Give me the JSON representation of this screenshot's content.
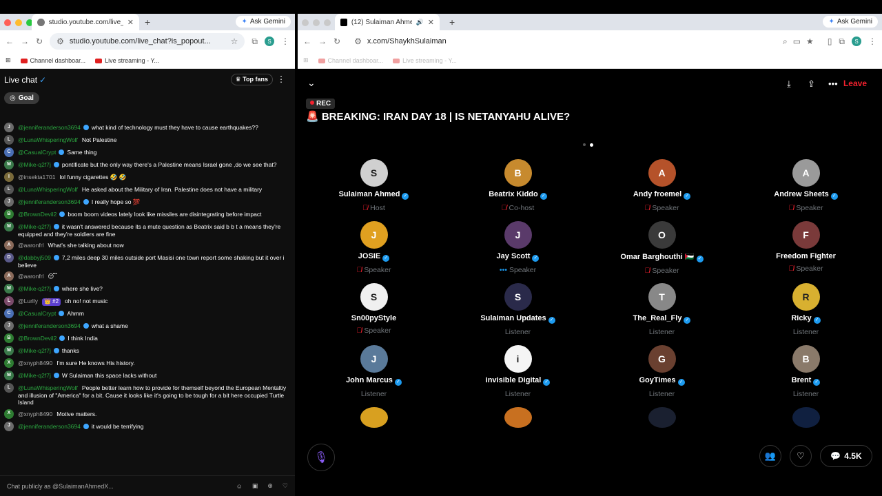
{
  "left": {
    "tab_title": "studio.youtube.com/live_chat",
    "gemini": "Ask Gemini",
    "url": "studio.youtube.com/live_chat?is_popout...",
    "bookmarks": [
      "Channel dashboar...",
      "Live streaming - Y..."
    ],
    "chat_title": "Live chat",
    "top_fans": "Top fans",
    "goal": "Goal",
    "input_placeholder": "Chat publicly as @SulaimanAhmedX...",
    "messages": [
      {
        "user": "@jenniferanderson3694",
        "text": "what kind of technology must they have to cause earthquakes??",
        "av": "J",
        "c": "#6b6b6b",
        "v": true
      },
      {
        "user": "@LunaWhisperingWolf",
        "text": "Not Palestine",
        "av": "L",
        "c": "#555",
        "v": false
      },
      {
        "user": "@CasualCrypt",
        "text": "Same thing",
        "av": "C",
        "c": "#4a6fb5",
        "v": true
      },
      {
        "user": "@Mike-q2f7j",
        "text": "pontificate but the only way there's a Palestine means Israel gone ,do we see that?",
        "av": "M",
        "c": "#3a7a4a",
        "v": true
      },
      {
        "user": "@insekta1701",
        "text": "lol funny cigarettes 🤣 🤣",
        "av": "I",
        "c": "#7a6a3a",
        "v": false,
        "gray": true
      },
      {
        "user": "@LunaWhisperingWolf",
        "text": "He asked about the Military of Iran. Palestine does not have a military",
        "av": "L",
        "c": "#555",
        "v": false
      },
      {
        "user": "@jenniferanderson3694",
        "text": "I really hope so 💯",
        "av": "J",
        "c": "#6b6b6b",
        "v": true
      },
      {
        "user": "@BrownDevil2",
        "text": "boom boom videos lately look like missiles are disintegrating before impact",
        "av": "B",
        "c": "#2e7d32",
        "v": true
      },
      {
        "user": "@Mike-q2f7j",
        "text": "it wasn't answered because its a mute question as Beatrix said b b t a means they're equipped and they're soldiers are fine",
        "av": "M",
        "c": "#3a7a4a",
        "v": true
      },
      {
        "user": "@aaronfrl",
        "text": "What's she talking about now",
        "av": "A",
        "c": "#8a6a5a",
        "v": false,
        "gray": true
      },
      {
        "user": "@dabbyj509",
        "text": "7,2 miles deep 30 miles outside port Masisi one town report some shaking but it over i believe",
        "av": "D",
        "c": "#5a5a8a",
        "v": true
      },
      {
        "user": "@aaronfrl",
        "text": "😴",
        "av": "A",
        "c": "#8a6a5a",
        "v": false,
        "gray": true
      },
      {
        "user": "@Mike-q2f7j",
        "text": "where she live?",
        "av": "M",
        "c": "#3a7a4a",
        "v": true
      },
      {
        "user": "@Lurlly",
        "text": "oh no! not music",
        "av": "L",
        "c": "#7a4a6a",
        "v": false,
        "gray": true,
        "badge": "👑 #2"
      },
      {
        "user": "@CasualCrypt",
        "text": "Ahmm",
        "av": "C",
        "c": "#4a6fb5",
        "v": true
      },
      {
        "user": "@jenniferanderson3694",
        "text": "what a shame",
        "av": "J",
        "c": "#6b6b6b",
        "v": true
      },
      {
        "user": "@BrownDevil2",
        "text": "I think India",
        "av": "B",
        "c": "#2e7d32",
        "v": true
      },
      {
        "user": "@Mike-q2f7j",
        "text": "thanks",
        "av": "M",
        "c": "#3a7a4a",
        "v": true
      },
      {
        "user": "@xnyph8490",
        "text": "I'm sure He knows His history.",
        "av": "X",
        "c": "#2e7d32",
        "v": false,
        "gray": true
      },
      {
        "user": "@Mike-q2f7j",
        "text": "W Sulaiman this space lacks without",
        "av": "M",
        "c": "#3a7a4a",
        "v": true
      },
      {
        "user": "@LunaWhisperingWolf",
        "text": "People better learn how to provide for themself beyond the European Mentaltiy and illusion of \"America\" for a bit. Cause it looks like it's going to be tough for a bit here occupied Turtle Island",
        "av": "L",
        "c": "#555",
        "v": false
      },
      {
        "user": "@xnyph8490",
        "text": "Motive matters.",
        "av": "X",
        "c": "#2e7d32",
        "v": false,
        "gray": true
      },
      {
        "user": "@jenniferanderson3694",
        "text": "it would be terrifying",
        "av": "J",
        "c": "#6b6b6b",
        "v": true
      }
    ]
  },
  "right": {
    "tab_title": "(12) Sulaiman Ahmed (@S...",
    "gemini": "Ask Gemini",
    "url": "x.com/ShaykhSulaiman",
    "bookmarks": [
      "Channel dashboar...",
      "Live streaming - Y..."
    ],
    "leave": "Leave",
    "rec": "REC",
    "title": "🚨 BREAKING: IRAN DAY 18 | IS NETANYAHU ALIVE?",
    "count": "4.5K",
    "participants": [
      {
        "name": "Sulaiman Ahmed",
        "role": "Host",
        "mut": true,
        "v": true,
        "c": "#d0d0d0",
        "i": "S"
      },
      {
        "name": "Beatrix Kiddo",
        "role": "Co-host",
        "mut": true,
        "v": true,
        "c": "#c78a2e",
        "i": "B"
      },
      {
        "name": "Andy froemel",
        "role": "Speaker",
        "mut": true,
        "v": true,
        "c": "#b5522a",
        "i": "A"
      },
      {
        "name": "Andrew Sheets",
        "role": "Speaker",
        "mut": true,
        "v": true,
        "c": "#9a9a9a",
        "i": "A"
      },
      {
        "name": "JOSIE",
        "role": "Speaker",
        "mut": true,
        "v": true,
        "c": "#e0a020",
        "i": "J"
      },
      {
        "name": "Jay Scott",
        "role": "Speaker",
        "mut": false,
        "v": true,
        "c": "#5a3a6a",
        "i": "J",
        "dots": "•••"
      },
      {
        "name": "Omar Barghouthi 🇵🇸",
        "role": "Speaker",
        "mut": true,
        "v": true,
        "c": "#3a3a3a",
        "i": "O"
      },
      {
        "name": "Freedom Fighter",
        "role": "Speaker",
        "mut": true,
        "v": false,
        "c": "#7a3a3a",
        "i": "F"
      },
      {
        "name": "Sn00pyStyle",
        "role": "Speaker",
        "mut": true,
        "v": false,
        "c": "#f0f0f0",
        "i": "S"
      },
      {
        "name": "Sulaiman Updates",
        "role": "Listener",
        "mut": false,
        "v": true,
        "c": "#2a2a4a",
        "i": "S"
      },
      {
        "name": "The_Real_Fly",
        "role": "Listener",
        "mut": false,
        "v": true,
        "c": "#888",
        "i": "T"
      },
      {
        "name": "Ricky",
        "role": "Listener",
        "mut": false,
        "v": true,
        "c": "#d8b030",
        "i": "R"
      },
      {
        "name": "John Marcus",
        "role": "Listener",
        "mut": false,
        "v": true,
        "c": "#5a7a9a",
        "i": "J"
      },
      {
        "name": "invisible Digital",
        "role": "Listener",
        "mut": false,
        "v": true,
        "c": "#f5f5f5",
        "i": "i"
      },
      {
        "name": "GoyTimes",
        "role": "Listener",
        "mut": false,
        "v": true,
        "c": "#6a4030",
        "i": "G"
      },
      {
        "name": "Brent",
        "role": "Listener",
        "mut": false,
        "v": true,
        "c": "#8a7a6a",
        "i": "B"
      }
    ],
    "partial_row": [
      {
        "c": "#d8a020"
      },
      {
        "c": "#c87020"
      },
      {
        "c": "#1a2030"
      },
      {
        "c": "#102040"
      }
    ]
  }
}
